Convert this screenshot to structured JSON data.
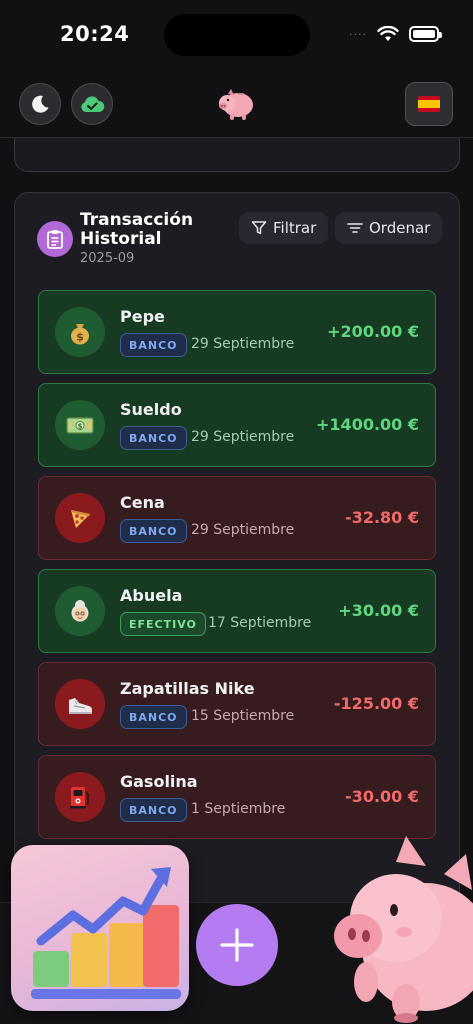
{
  "status_bar": {
    "time": "20:24",
    "signal": "····"
  },
  "header": {
    "logo_icon": "piggy-bank-icon",
    "language_flag": "spain-flag-icon"
  },
  "history": {
    "title": "Transacción Historial",
    "period": "2025-09",
    "filter_label": "Filtrar",
    "sort_label": "Ordenar"
  },
  "transactions": [
    {
      "name": "Pepe",
      "method": "BANCO",
      "date": "29 Septiembre",
      "amount": "+200.00 €",
      "type": "income",
      "icon": "money-bag-icon"
    },
    {
      "name": "Sueldo",
      "method": "BANCO",
      "date": "29 Septiembre",
      "amount": "+1400.00 €",
      "type": "income",
      "icon": "banknotes-icon"
    },
    {
      "name": "Cena",
      "method": "BANCO",
      "date": "29 Septiembre",
      "amount": "-32.80 €",
      "type": "expense",
      "icon": "pizza-icon"
    },
    {
      "name": "Abuela",
      "method": "EFECTIVO",
      "date": "17 Septiembre",
      "amount": "+30.00 €",
      "type": "income",
      "icon": "grandma-icon"
    },
    {
      "name": "Zapatillas Nike",
      "method": "BANCO",
      "date": "15 Septiembre",
      "amount": "-125.00 €",
      "type": "expense",
      "icon": "sneaker-icon"
    },
    {
      "name": "Gasolina",
      "method": "BANCO",
      "date": "1 Septiembre",
      "amount": "-30.00 €",
      "type": "expense",
      "icon": "fuel-pump-icon"
    }
  ],
  "colors": {
    "income_bg": "#173a23",
    "income_text": "#5fd67d",
    "expense_bg": "#361b1f",
    "expense_text": "#f26a6a",
    "accent": "#b57bf0",
    "banco_badge": "#7fa9f0",
    "efectivo_badge": "#7fe39a"
  }
}
